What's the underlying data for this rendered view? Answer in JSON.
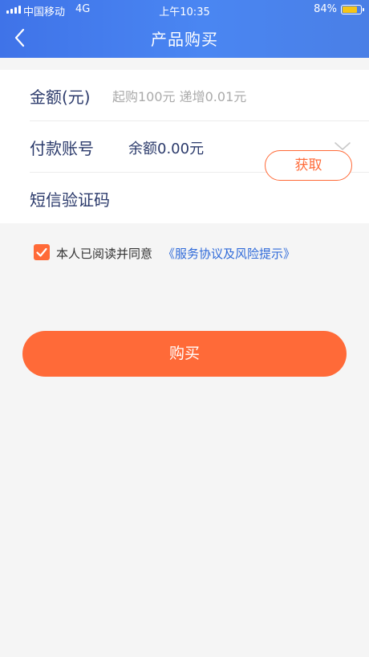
{
  "status_bar": {
    "carrier": "中国移动",
    "network": "4G",
    "time": "上午10:35",
    "battery_percent": "84%",
    "battery_level": 0.84,
    "battery_color": "#f5c518"
  },
  "nav": {
    "title": "产品购买",
    "back_icon": "chevron-left-icon"
  },
  "form": {
    "amount": {
      "label": "金额(元)",
      "placeholder": "起购100元 递增0.01元",
      "value": ""
    },
    "account": {
      "label": "付款账号",
      "value": "余额0.00元",
      "icon": "chevron-down-icon"
    },
    "sms": {
      "label": "短信验证码",
      "button_label": "获取"
    }
  },
  "agreement": {
    "checked": true,
    "text": "本人已阅读并同意",
    "link": "《服务协议及风险提示》"
  },
  "buy_button": {
    "label": "购买"
  },
  "colors": {
    "header_start": "#3f73e8",
    "header_end": "#4a86f2",
    "accent": "#ff6a38",
    "label_text": "#2b3a6b",
    "link": "#2f6ad9",
    "background": "#f5f5f5"
  }
}
